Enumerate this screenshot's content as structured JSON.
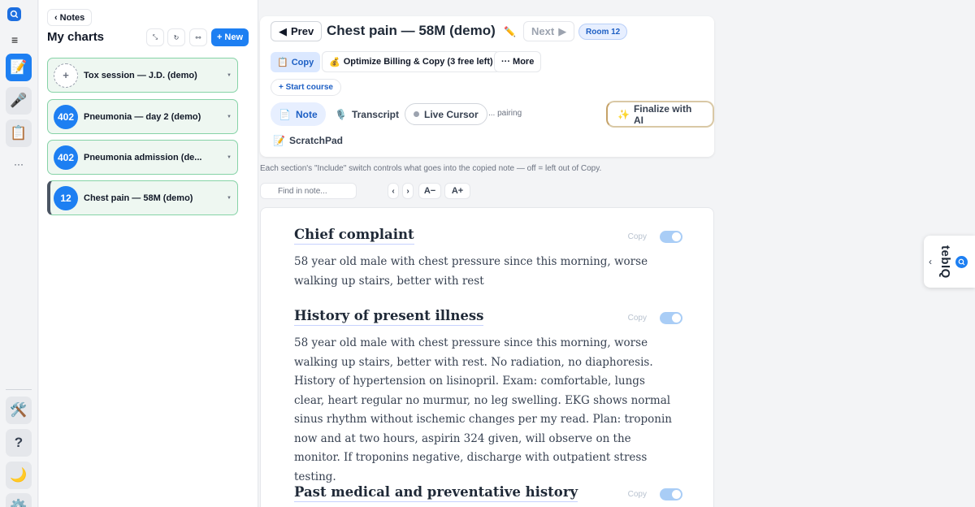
{
  "rail": {
    "items": [
      {
        "name": "notes",
        "icon": "📝",
        "active": true
      },
      {
        "name": "mic",
        "icon": "🎤"
      },
      {
        "name": "clipboard",
        "icon": "📋"
      },
      {
        "name": "more",
        "icon": "···"
      }
    ],
    "bottom": [
      {
        "name": "tools",
        "icon": "🛠️"
      },
      {
        "name": "help",
        "icon": "?"
      },
      {
        "name": "theme",
        "icon": "🌙"
      },
      {
        "name": "settings",
        "icon": "⚙️"
      }
    ]
  },
  "panel": {
    "back_label": "Notes",
    "title": "My charts",
    "new_label": "+ New",
    "charts": [
      {
        "room": "",
        "title": "Tox session — J.D. (demo)"
      },
      {
        "room": "402",
        "title": "Pneumonia — day 2 (demo)"
      },
      {
        "room": "402",
        "title": "Pneumonia admission (de..."
      },
      {
        "room": "12",
        "title": "Chest pain — 58M (demo)"
      }
    ]
  },
  "header": {
    "prev_label": "Prev",
    "title": "Chest pain — 58M (demo)",
    "next_label": "Next",
    "room_badge": "Room 12",
    "copy_label": "Copy",
    "optimize_label": "Optimize Billing & Copy (3 free left)",
    "more_label": "··· More",
    "start_course_label": "+ Start course",
    "tabs": {
      "note": "Note",
      "transcript": "Transcript",
      "live_cursor": "Live Cursor",
      "pairing": "... pairing",
      "finalize": "Finalize with AI",
      "scratchpad": "ScratchPad"
    }
  },
  "hint": "Each section's \"Include\" switch controls what goes into the copied note — off = left out of Copy.",
  "find": {
    "placeholder": "Find in note..."
  },
  "font_controls": {
    "prev": "‹",
    "next": "›",
    "decrease": "A−",
    "increase": "A+"
  },
  "sections": [
    {
      "heading": "Chief complaint",
      "copy_label": "Copy",
      "body": "58 year old male with chest pressure since this morning, worse walking up stairs, better with rest"
    },
    {
      "heading": "History of present illness",
      "copy_label": "Copy",
      "body": "58 year old male with chest pressure since this morning, worse walking up stairs, better with rest. No radiation, no diaphoresis. History of hypertension on lisinopril. Exam: comfortable, lungs clear, heart regular no murmur, no leg swelling. EKG shows normal sinus rhythm without ischemic changes per my read. Plan: troponin now and at two hours, aspirin 324 given, will observe on the monitor. If troponins negative, discharge with outpatient stress testing."
    },
    {
      "heading": "Past medical and preventative history",
      "copy_label": "Copy",
      "body": ""
    }
  ],
  "side_tab": {
    "brand": "tebIQ"
  },
  "colors": {
    "accent": "#1d7ff2",
    "card_border": "#86d3a7",
    "card_bg": "#eef7f1"
  }
}
